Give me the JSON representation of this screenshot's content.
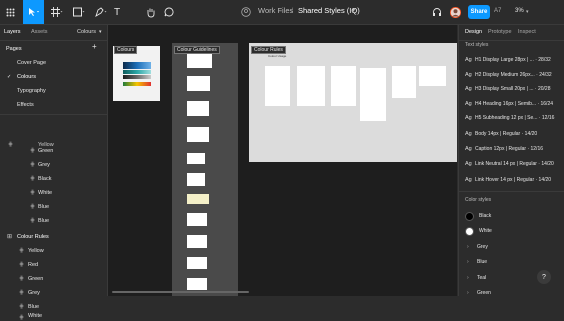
{
  "toolbar": {
    "tools": [
      "main-menu",
      "move",
      "frame",
      "shape",
      "pen",
      "text",
      "hand",
      "comment"
    ],
    "text_tool_glyph": "T",
    "breadcrumb_team": "Work Files",
    "breadcrumb_sep": "/",
    "breadcrumb_file": "Shared Styles (IQ)",
    "share_label": "Share",
    "avatar_initials": "A7",
    "zoom": "3%",
    "zoom_caret": "▾"
  },
  "left_panel": {
    "tabs": [
      "Layers",
      "Assets",
      "Colours"
    ],
    "colours_caret": "▾",
    "pages_heading": "Pages",
    "add_page": "+",
    "pages": [
      "Cover Page",
      "Colours",
      "Typography",
      "Effects"
    ],
    "current_page_mark": "✓",
    "layers_before": [
      "Yellow",
      "Green",
      "Grey",
      "Black",
      "White",
      "Blue",
      "Blue"
    ],
    "layer_frame": "Colour Rules",
    "layers_after": [
      "Yellow",
      "Red",
      "Green",
      "Grey",
      "Blue"
    ],
    "last_layer": "White"
  },
  "canvas": {
    "frames": [
      "Colours",
      "Colour Guidelines",
      "Colour Rules"
    ],
    "mini_header_caption": "Colour Usage"
  },
  "right_panel": {
    "tabs": [
      "Design",
      "Prototype",
      "Inspect"
    ],
    "text_styles_heading": "Text styles",
    "text_style_glyph": "Ag",
    "text_styles": [
      "H1 Display Large 28px | ... · 28/32",
      "H2 Display Medium 26px... · 24/32",
      "H3 Display Small 20px | ... · 20/28",
      "H4 Heading 16px | Semib... · 16/24",
      "H5 Subheading 12 px | Se... · 12/16",
      "Body 14px | Regular · 14/20",
      "Caption 12px | Regular · 12/16",
      "Link Neutral 14 px | Regular · 14/20",
      "Link Hover 14 px | Regular · 14/20"
    ],
    "color_styles_heading": "Color styles",
    "color_styles": [
      {
        "name": "Black",
        "color": "#000000"
      },
      {
        "name": "White",
        "color": "#ffffff"
      }
    ],
    "color_groups_caret": "›",
    "color_groups": [
      "Grey",
      "Blue",
      "Teal",
      "Green"
    ]
  },
  "help": "?"
}
